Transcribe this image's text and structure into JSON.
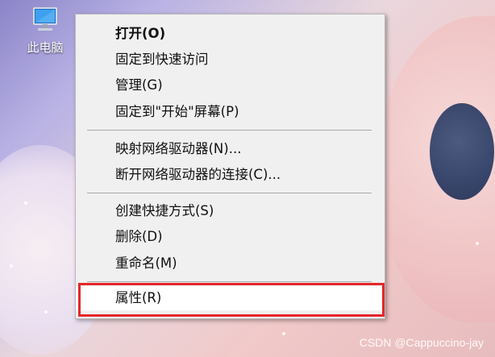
{
  "desktop": {
    "icon_label": "此电脑",
    "icon_name": "this-pc-icon"
  },
  "menu": {
    "items": [
      {
        "label": "打开(O)",
        "bold": true
      },
      {
        "label": "固定到快速访问"
      },
      {
        "label": "管理(G)"
      },
      {
        "label": "固定到\"开始\"屏幕(P)"
      },
      {
        "label": "映射网络驱动器(N)..."
      },
      {
        "label": "断开网络驱动器的连接(C)..."
      },
      {
        "label": "创建快捷方式(S)"
      },
      {
        "label": "删除(D)"
      },
      {
        "label": "重命名(M)"
      },
      {
        "label": "属性(R)"
      }
    ],
    "highlight_color": "#e5262a"
  },
  "watermark": "CSDN @Cappuccino-jay"
}
